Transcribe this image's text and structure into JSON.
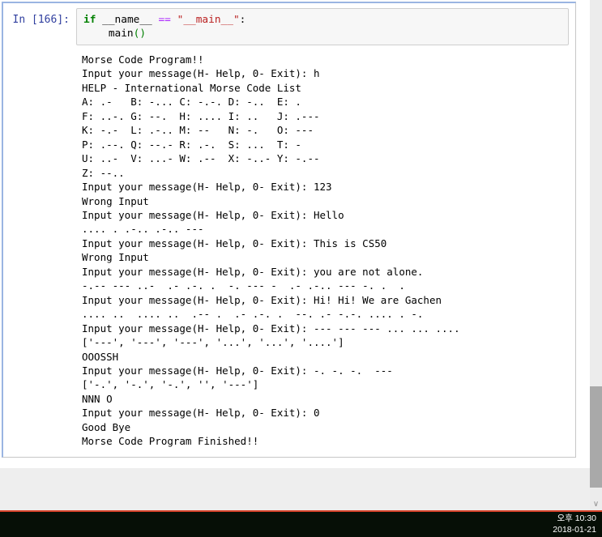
{
  "cell": {
    "prompt": "In [166]:",
    "code": {
      "line1": [
        {
          "type": "kw",
          "text": "if"
        },
        {
          "type": "plain",
          "text": " __name__ "
        },
        {
          "type": "op",
          "text": "=="
        },
        {
          "type": "plain",
          "text": " "
        },
        {
          "type": "str",
          "text": "\"__main__\""
        },
        {
          "type": "plain",
          "text": ":"
        }
      ],
      "line2": [
        {
          "type": "plain",
          "text": "    main"
        },
        {
          "type": "bracket",
          "text": "()"
        }
      ]
    },
    "output_lines": [
      "Morse Code Program!!",
      "Input your message(H- Help, 0- Exit): h",
      "HELP - International Morse Code List",
      "A: .-   B: -... C: -.-. D: -..  E: .",
      "F: ..-. G: --.  H: .... I: ..   J: .---",
      "K: -.-  L: .-.. M: --   N: -.   O: ---",
      "P: .--. Q: --.- R: .-.  S: ...  T: -",
      "U: ..-  V: ...- W: .--  X: -..- Y: -.--",
      "Z: --..",
      "Input your message(H- Help, 0- Exit): 123",
      "Wrong Input",
      "Input your message(H- Help, 0- Exit): Hello",
      ".... . .-.. .-.. ---",
      "Input your message(H- Help, 0- Exit): This is CS50",
      "Wrong Input",
      "Input your message(H- Help, 0- Exit): you are not alone.",
      "-.-- --- ..-  .- .-. .  -. --- -  .- .-.. --- -. .  .",
      "Input your message(H- Help, 0- Exit): Hi! Hi! We are Gachen",
      ".... ..  .... ..  .-- .  .- .-. .  --. .- -.-. .... . -.",
      "Input your message(H- Help, 0- Exit): --- --- --- ... ... ....",
      "['---', '---', '---', '...', '...', '....']",
      "OOOSSH",
      "Input your message(H- Help, 0- Exit): -. -. -.  ---",
      "['-.', '-.', '-.', '', '---']",
      "NNN O",
      "Input your message(H- Help, 0- Exit): 0",
      "Good Bye",
      "Morse Code Program Finished!!"
    ]
  },
  "scrollbar": {
    "down_glyph": "∨"
  },
  "taskbar": {
    "time": "오후 10:30",
    "date": "2018-01-21"
  },
  "colors": {
    "cell_selected_border": "#9ab5e2",
    "cell_border": "#c6c6c6",
    "prompt_blue": "#303F9F",
    "keyword_green": "#008000",
    "operator_purple": "#AA22FF",
    "string_red": "#BA2121",
    "input_bg": "#f7f7f7",
    "taskbar_bg": "#060f06",
    "accent_red_line": "#d6432a",
    "scroll_thumb": "#a9a9a9"
  }
}
